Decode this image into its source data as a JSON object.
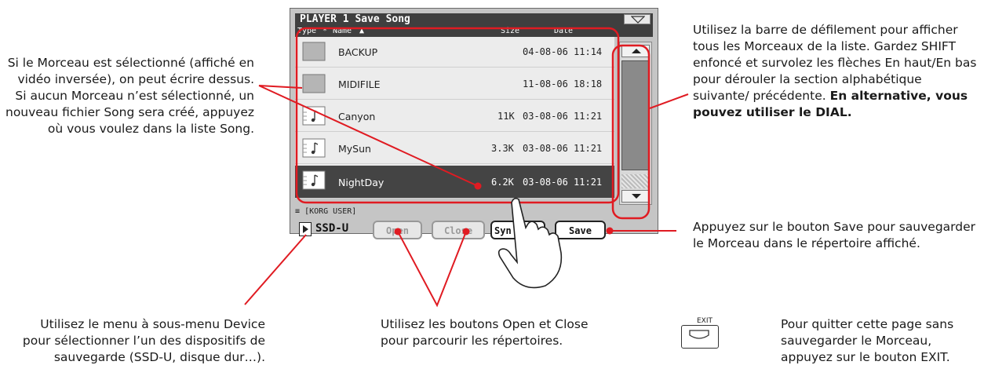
{
  "screen": {
    "title": "PLAYER 1  Save Song",
    "columns": {
      "type": "Type",
      "star": "*",
      "name": "Name",
      "size": "Size",
      "date": "Date"
    },
    "files": [
      {
        "name": "BACKUP",
        "size": "",
        "date": "04-08-06 11:14",
        "icon": "folder-icon"
      },
      {
        "name": "MIDIFILE",
        "size": "",
        "date": "11-08-06 18:18",
        "icon": "folder-icon"
      },
      {
        "name": "Canyon",
        "size": "11K",
        "date": "03-08-06 11:21",
        "icon": "song-file-icon"
      },
      {
        "name": "MySun",
        "size": "3.3K",
        "date": "03-08-06 11:21",
        "icon": "song-file-icon"
      },
      {
        "name": "NightDay",
        "size": "6.2K",
        "date": "03-08-06 11:21",
        "icon": "song-file-icon",
        "selected": true
      }
    ],
    "path": "[KORG USER]",
    "device": "SSD-U",
    "buttons": {
      "open": "Open",
      "close": "Close",
      "sync": "Syn",
      "save": "Save"
    },
    "highlight_color": "#e01b22"
  },
  "notes": {
    "left_top": "Si le Morceau est sélectionné (affiché en vidéo inversée), on peut écrire dessus. Si aucun Morceau n’est sélectionné, un nouveau fichier Song sera créé, appuyez où vous voulez dans la liste Song.",
    "right_top": "Utilisez la barre de défilement pour afficher tous les Morceaux de la liste. Gardez SHIFT enfoncé et survolez les flèches En haut/En bas pour dérouler la section alphabétique suivante/ précédente.",
    "right_top_bold": "En alternative, vous pouvez utiliser le DIAL.",
    "right_mid": "Appuyez sur le bouton Save pour sauvegarder le Morceau dans le répertoire affiché.",
    "bottom_left": "Utilisez le menu à sous-menu Device pour sélectionner l’un des dispositifs de sauvegarde (SSD-U, disque dur…).",
    "bottom_mid": "Utilisez les boutons Open et Close pour parcourir les répertoires.",
    "exit_label": "EXIT",
    "exit_note": "Pour quitter cette page sans sauvegarder le Morceau, appuyez sur le bouton EXIT."
  }
}
